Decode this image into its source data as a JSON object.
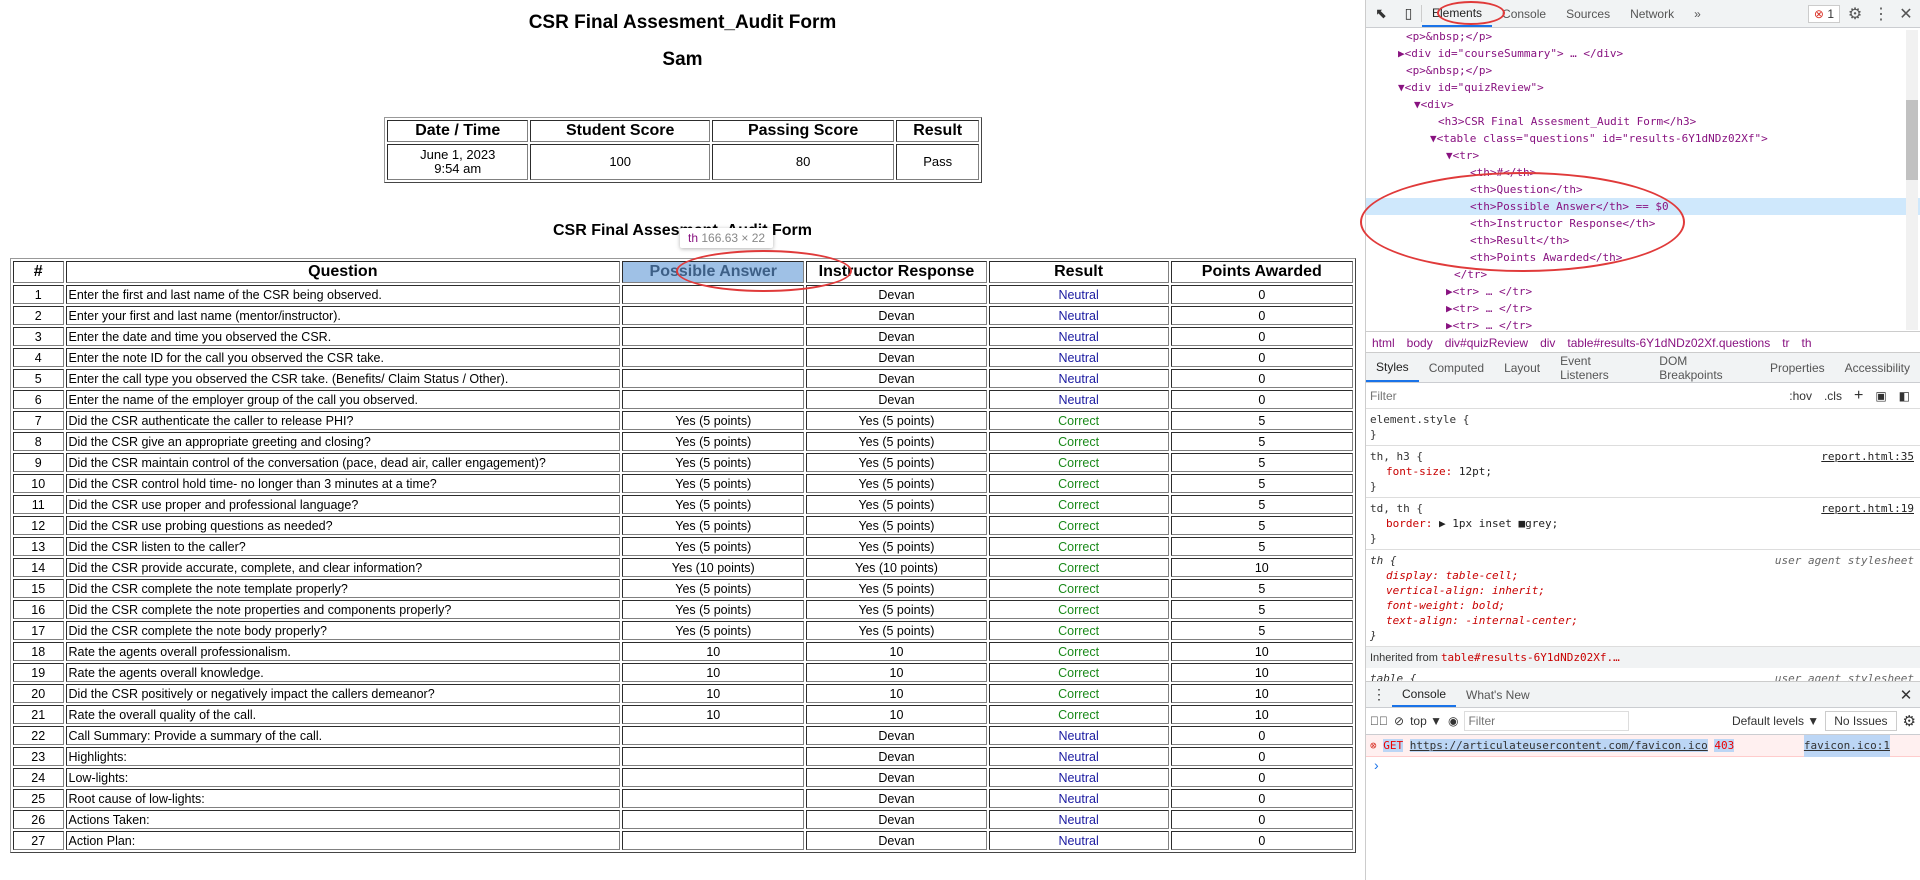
{
  "page": {
    "title": "CSR Final Assesment_Audit Form",
    "student": "Sam",
    "summary": {
      "headers": [
        "Date / Time",
        "Student Score",
        "Passing Score",
        "Result"
      ],
      "date": "June 1, 2023",
      "time": "9:54 am",
      "student_score": "100",
      "passing_score": "80",
      "result": "Pass"
    },
    "quiz_title": "CSR Final Assesment_Audit Form",
    "tooltip": {
      "tag": "th",
      "size": "166.63 × 22"
    },
    "headers": [
      "#",
      "Question",
      "Possible Answer",
      "Instructor Response",
      "Result",
      "Points Awarded"
    ],
    "rows": [
      [
        "1",
        "Enter the first and last name of the CSR being observed.",
        "",
        "Devan",
        "Neutral",
        "0"
      ],
      [
        "2",
        "Enter your first and last name (mentor/instructor).",
        "",
        "Devan",
        "Neutral",
        "0"
      ],
      [
        "3",
        "Enter the date and time you observed the CSR.",
        "",
        "Devan",
        "Neutral",
        "0"
      ],
      [
        "4",
        "Enter the note ID for the call you observed the CSR take.",
        "",
        "Devan",
        "Neutral",
        "0"
      ],
      [
        "5",
        "Enter the call type you observed the CSR take. (Benefits/ Claim Status / Other).",
        "",
        "Devan",
        "Neutral",
        "0"
      ],
      [
        "6",
        "Enter the name of the employer group of the call you observed.",
        "",
        "Devan",
        "Neutral",
        "0"
      ],
      [
        "7",
        "Did the CSR authenticate the caller to release PHI?",
        "Yes (5 points)",
        "Yes (5 points)",
        "Correct",
        "5"
      ],
      [
        "8",
        "Did the CSR give an appropriate greeting and closing?",
        "Yes (5 points)",
        "Yes (5 points)",
        "Correct",
        "5"
      ],
      [
        "9",
        "Did the CSR maintain control of the conversation (pace, dead air, caller engagement)?",
        "Yes (5 points)",
        "Yes (5 points)",
        "Correct",
        "5"
      ],
      [
        "10",
        "Did the CSR control hold time- no longer than 3 minutes at a time?",
        "Yes (5 points)",
        "Yes (5 points)",
        "Correct",
        "5"
      ],
      [
        "11",
        "Did the CSR use proper and professional language?",
        "Yes (5 points)",
        "Yes (5 points)",
        "Correct",
        "5"
      ],
      [
        "12",
        "Did the CSR use probing questions as needed?",
        "Yes (5 points)",
        "Yes (5 points)",
        "Correct",
        "5"
      ],
      [
        "13",
        "Did the CSR listen to the caller?",
        "Yes (5 points)",
        "Yes (5 points)",
        "Correct",
        "5"
      ],
      [
        "14",
        "Did the CSR provide accurate, complete, and clear information?",
        "Yes (10 points)",
        "Yes (10 points)",
        "Correct",
        "10"
      ],
      [
        "15",
        "Did the CSR complete the note template properly?",
        "Yes (5 points)",
        "Yes (5 points)",
        "Correct",
        "5"
      ],
      [
        "16",
        "Did the CSR complete the note properties and components properly?",
        "Yes (5 points)",
        "Yes (5 points)",
        "Correct",
        "5"
      ],
      [
        "17",
        "Did the CSR complete the note body properly?",
        "Yes (5 points)",
        "Yes (5 points)",
        "Correct",
        "5"
      ],
      [
        "18",
        "Rate the agents overall professionalism.",
        "10",
        "10",
        "Correct",
        "10"
      ],
      [
        "19",
        "Rate the agents overall knowledge.",
        "10",
        "10",
        "Correct",
        "10"
      ],
      [
        "20",
        "Did the CSR positively or negatively impact the callers demeanor?",
        "10",
        "10",
        "Correct",
        "10"
      ],
      [
        "21",
        "Rate the overall quality of the call.",
        "10",
        "10",
        "Correct",
        "10"
      ],
      [
        "22",
        "Call Summary: Provide a summary of the call.",
        "",
        "Devan",
        "Neutral",
        "0"
      ],
      [
        "23",
        "Highlights:",
        "",
        "Devan",
        "Neutral",
        "0"
      ],
      [
        "24",
        "Low-lights:",
        "",
        "Devan",
        "Neutral",
        "0"
      ],
      [
        "25",
        "Root cause of low-lights:",
        "",
        "Devan",
        "Neutral",
        "0"
      ],
      [
        "26",
        "Actions Taken:",
        "",
        "Devan",
        "Neutral",
        "0"
      ],
      [
        "27",
        "Action Plan:",
        "",
        "Devan",
        "Neutral",
        "0"
      ]
    ]
  },
  "devtools": {
    "tabs": [
      "Elements",
      "Console",
      "Sources",
      "Network",
      "»"
    ],
    "error_count": "1",
    "tree": [
      {
        "indent": 5,
        "text": "<p>&nbsp;</p>"
      },
      {
        "indent": 4,
        "text": "▶<div id=\"courseSummary\"> … </div>"
      },
      {
        "indent": 5,
        "text": "<p>&nbsp;</p>"
      },
      {
        "indent": 4,
        "text": "▼<div id=\"quizReview\">"
      },
      {
        "indent": 6,
        "text": "▼<div>"
      },
      {
        "indent": 9,
        "text": "<h3>CSR Final Assesment_Audit Form</h3>"
      },
      {
        "indent": 8,
        "text": "▼<table class=\"questions\" id=\"results-6Y1dNDz02Xf\">"
      },
      {
        "indent": 10,
        "text": "▼<tr>"
      },
      {
        "indent": 13,
        "text": "<th>#</th>"
      },
      {
        "indent": 13,
        "text": "<th>Question</th>"
      },
      {
        "indent": 13,
        "text": "<th>Possible Answer</th> == $0",
        "selected": true
      },
      {
        "indent": 13,
        "text": "<th>Instructor Response</th>"
      },
      {
        "indent": 13,
        "text": "<th>Result</th>"
      },
      {
        "indent": 13,
        "text": "<th>Points Awarded</th>"
      },
      {
        "indent": 11,
        "text": "</tr>"
      },
      {
        "indent": 10,
        "text": "▶<tr> … </tr>"
      },
      {
        "indent": 10,
        "text": "▶<tr> … </tr>"
      },
      {
        "indent": 10,
        "text": "▶<tr> … </tr>"
      }
    ],
    "breadcrumb": [
      "html",
      "body",
      "div#quizReview",
      "div",
      "table#results-6Y1dNDz02Xf.questions",
      "tr",
      "th"
    ],
    "style_tabs": [
      "Styles",
      "Computed",
      "Layout",
      "Event Listeners",
      "DOM Breakpoints",
      "Properties",
      "Accessibility"
    ],
    "filter_placeholder": "Filter",
    "hov": ":hov",
    "cls": ".cls",
    "rules": {
      "element_style": "element.style {",
      "r1_sel": "th, h3 {",
      "r1_src": "report.html:35",
      "r1_prop": "font-size",
      "r1_val": "12pt;",
      "r2_sel": "td, th {",
      "r2_src": "report.html:19",
      "r2_prop": "border",
      "r2_val": "▶ 1px inset ■grey;",
      "r3_sel": "th {",
      "r3_src": "user agent stylesheet",
      "r3_props": [
        "display: table-cell;",
        "vertical-align: inherit;",
        "font-weight: bold;",
        "text-align: -internal-center;"
      ],
      "inherited_label": "Inherited from",
      "inherited_from": "table#results-6Y1dNDz02Xf.…",
      "r4_sel": "table {",
      "r4_src": "user agent stylesheet"
    },
    "drawer_tabs": [
      "Console",
      "What's New"
    ],
    "console": {
      "context": "top ▼",
      "filter_placeholder": "Filter",
      "levels": "Default levels ▼",
      "issues": "No Issues",
      "error_method": "GET",
      "error_url": "https://articulateusercontent.com/favicon.ico",
      "error_status": "403",
      "error_src": "favicon.ico:1",
      "prompt": "›"
    }
  }
}
